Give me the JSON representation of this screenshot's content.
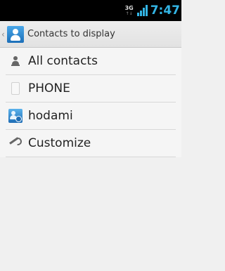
{
  "status_bar": {
    "network": "3G",
    "network_arrows": "↑↓",
    "signal_bars": 4,
    "time": "7:47",
    "colors": {
      "time": "#33b5e5",
      "signal": "#33b5e5"
    }
  },
  "action_bar": {
    "up_caret": "‹",
    "title": "Contacts to display",
    "icon": "contacts-app-icon"
  },
  "options": [
    {
      "label": "All contacts",
      "icon": "person-icon"
    },
    {
      "label": "PHONE",
      "icon": "phone-icon"
    },
    {
      "label": "hodami",
      "icon": "account-icon"
    },
    {
      "label": "Customize",
      "icon": "wrench-icon"
    }
  ]
}
